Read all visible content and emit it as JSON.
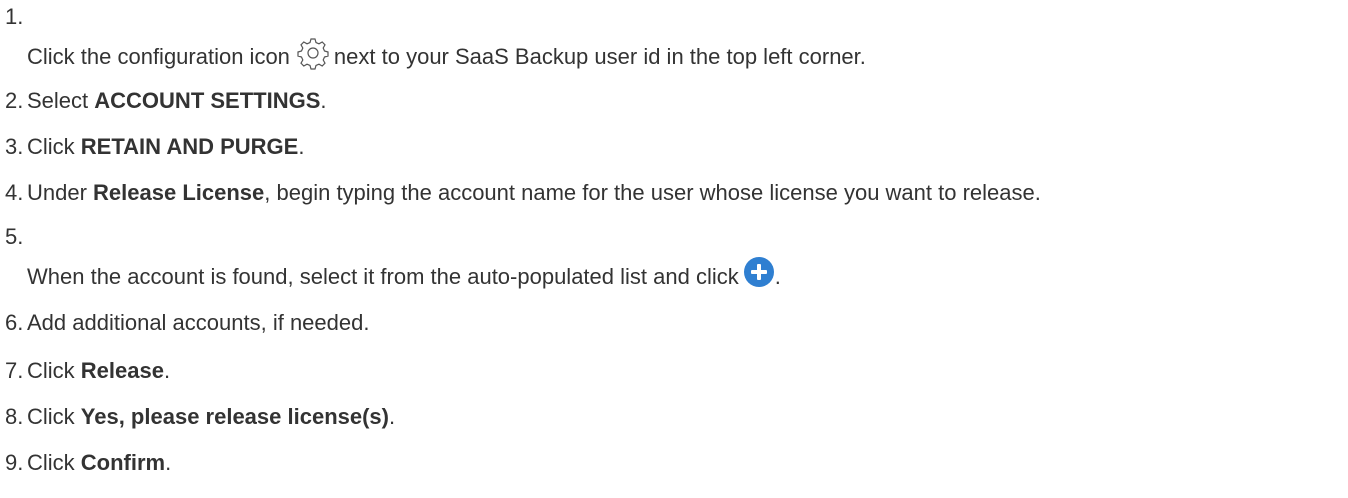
{
  "steps": [
    {
      "num": "1.",
      "before": "Click the configuration icon",
      "icon": "gear-icon",
      "after": "next to your SaaS Backup user id in the top left corner."
    },
    {
      "num": "2.",
      "before": "Select ",
      "bold": "ACCOUNT SETTINGS",
      "after": "."
    },
    {
      "num": "3.",
      "before": "Click ",
      "bold": "RETAIN AND PURGE",
      "after": "."
    },
    {
      "num": "4.",
      "before": "Under ",
      "bold": "Release License",
      "after": ", begin typing the account name for the user whose license you want to release."
    },
    {
      "num": "5.",
      "before": "When the account is found, select it from the auto-populated list and click",
      "icon": "plus-circle-icon",
      "after": "."
    },
    {
      "num": "6.",
      "before": "Add additional accounts, if needed."
    },
    {
      "num": "7.",
      "before": "Click ",
      "bold": "Release",
      "after": "."
    },
    {
      "num": "8.",
      "before": "Click ",
      "bold": "Yes, please release license(s)",
      "after": "."
    },
    {
      "num": "9.",
      "before": "Click ",
      "bold": "Confirm",
      "after": "."
    }
  ],
  "colors": {
    "text": "#333333",
    "icon_blue": "#2f7fd1"
  }
}
